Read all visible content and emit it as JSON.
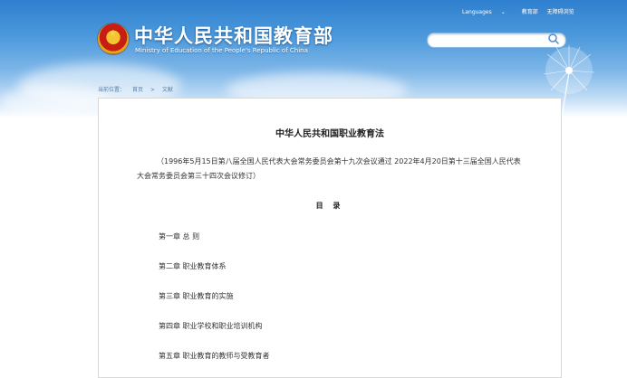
{
  "header": {
    "site_title": "中华人民共和国教育部",
    "site_subtitle": "Ministry of Education of the People's Republic of China",
    "top_links": {
      "languages": "Languages",
      "link2": "教育部",
      "link3": "无障碍浏览"
    },
    "search": {
      "placeholder": ""
    }
  },
  "breadcrumb": [
    "当前位置：",
    "首页",
    ">",
    "文献"
  ],
  "document": {
    "title": "中华人民共和国职业教育法",
    "note": "（1996年5月15日第八届全国人民代表大会常务委员会第十九次会议通过 2022年4月20日第十三届全国人民代表大会常务委员会第三十四次会议修订）",
    "toc_title": "目 录",
    "chapters": [
      "第一章 总 则",
      "第二章 职业教育体系",
      "第三章 职业教育的实施",
      "第四章 职业学校和职业培训机构",
      "第五章 职业教育的教师与受教育者"
    ]
  },
  "colors": {
    "header_blue": "#2e7fcf",
    "text": "#333333"
  }
}
